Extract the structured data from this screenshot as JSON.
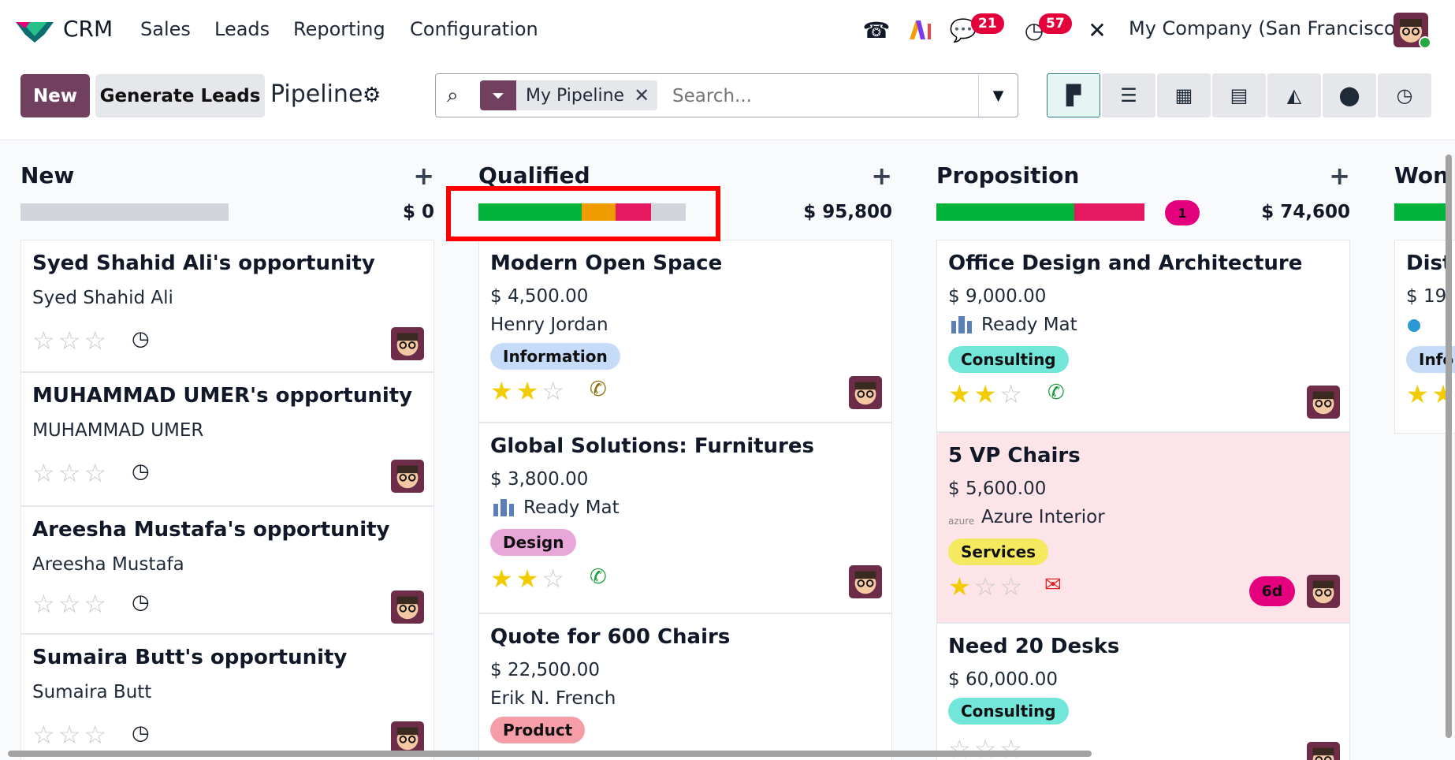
{
  "app": {
    "name": "CRM",
    "menu": [
      "Sales",
      "Leads",
      "Reporting",
      "Configuration"
    ],
    "notifications": {
      "messages": "21",
      "activities": "57"
    },
    "company": "My Company (San Francisco)"
  },
  "control": {
    "new_label": "New",
    "generate_label": "Generate Leads",
    "breadcrumb": "Pipeline",
    "facet": "My Pipeline",
    "search_placeholder": "Search...",
    "views": [
      "kanban-icon",
      "list-icon",
      "calendar-icon",
      "pivot-icon",
      "graph-icon",
      "map-icon",
      "activity-icon"
    ]
  },
  "columns": [
    {
      "title": "New",
      "total": "$ 0",
      "cards": [
        {
          "title": "Syed Shahid Ali's opportunity",
          "line1": "Syed Shahid Ali"
        },
        {
          "title": "MUHAMMAD UMER's opportunity",
          "line1": "MUHAMMAD UMER"
        },
        {
          "title": "Areesha Mustafa's opportunity",
          "line1": "Areesha Mustafa"
        },
        {
          "title": "Sumaira Butt's opportunity",
          "line1": "Sumaira Butt"
        }
      ]
    },
    {
      "title": "Qualified",
      "total": "$ 95,800",
      "cards": [
        {
          "title": "Modern Open Space",
          "amount": "$ 4,500.00",
          "line1": "Henry Jordan",
          "tag": "Information",
          "tag_color": "#c6dbf7"
        },
        {
          "title": "Global Solutions: Furnitures",
          "amount": "$ 3,800.00",
          "line1": "Ready Mat",
          "tag": "Design",
          "tag_color": "#e9a6d8"
        },
        {
          "title": "Quote for 600 Chairs",
          "amount": "$ 22,500.00",
          "line1": "Erik N. French",
          "tag": "Product",
          "tag_color": "#f59ea7"
        }
      ]
    },
    {
      "title": "Proposition",
      "total": "$ 74,600",
      "count": "1",
      "cards": [
        {
          "title": "Office Design and Architecture",
          "amount": "$ 9,000.00",
          "line1": "Ready Mat",
          "tag": "Consulting",
          "tag_color": "#72e6d8"
        },
        {
          "title": "5 VP Chairs",
          "amount": "$ 5,600.00",
          "line1": "Azure Interior",
          "tag": "Services",
          "tag_color": "#f5e960",
          "deadline": "6d"
        },
        {
          "title": "Need 20 Desks",
          "amount": "$ 60,000.00",
          "tag": "Consulting",
          "tag_color": "#72e6d8"
        }
      ]
    },
    {
      "title": "Won",
      "cards": [
        {
          "title": "Dist",
          "amount": "$ 19",
          "tag": "Info",
          "tag_color": "#c6dbf7"
        }
      ]
    }
  ],
  "colors": {
    "brand": "#71405f",
    "green": "#02b33b",
    "orange": "#f09c00",
    "red": "#e5195f",
    "grey": "#d1d5db"
  }
}
